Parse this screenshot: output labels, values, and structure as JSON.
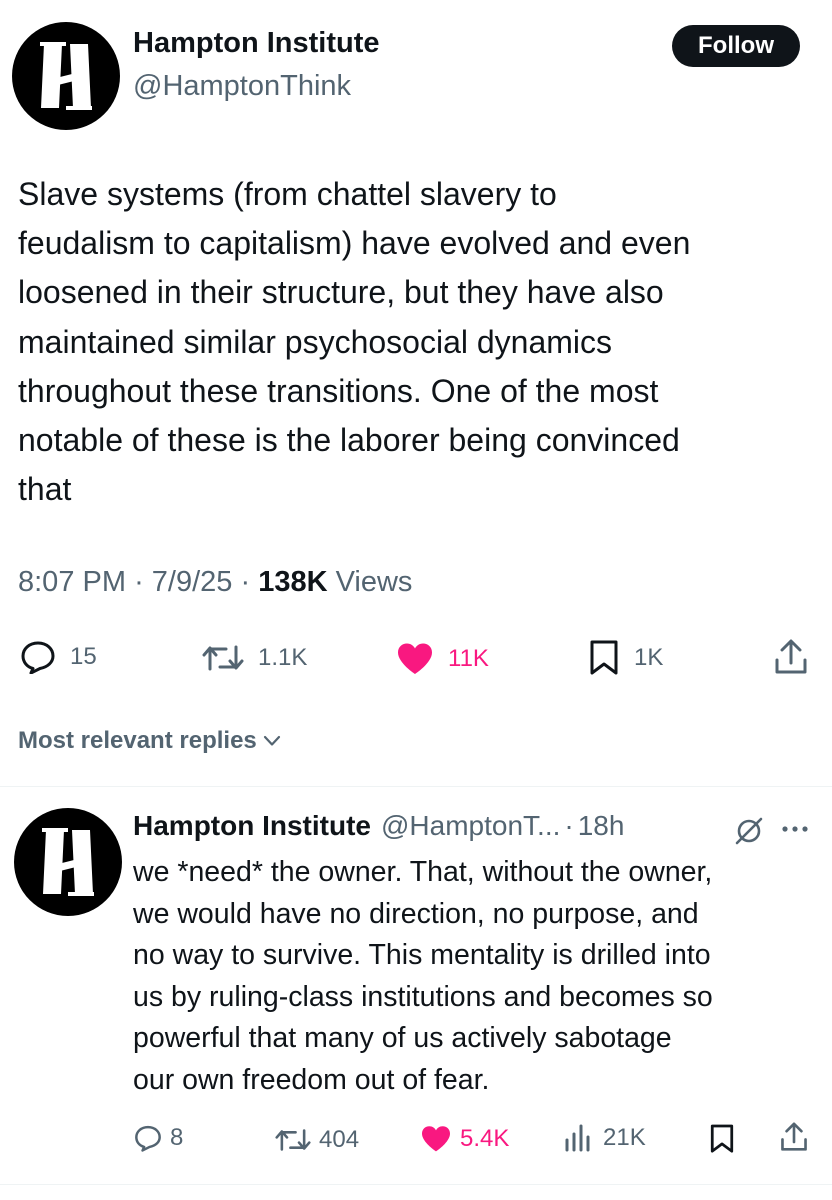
{
  "main_post": {
    "author_name": "Hampton Institute",
    "author_handle": "@HamptonThink",
    "follow_label": "Follow",
    "text": "Slave systems (from chattel slavery to\nfeudalism to capitalism) have evolved and even\nloosened in their structure, but they have also\nmaintained similar psychosocial dynamics\nthroughout these transitions. One of the most\nnotable of these is the laborer being convinced\nthat",
    "time": "8:07 PM",
    "date": "7/9/25",
    "views_count": "138K",
    "views_label": "Views",
    "actions": {
      "replies": "15",
      "reposts": "1.1K",
      "likes": "11K",
      "bookmarks": "1K"
    }
  },
  "replies_sort_label": "Most relevant replies",
  "reply": {
    "author_name": "Hampton Institute",
    "author_handle": "@HamptonT...",
    "separator": "·",
    "time": "18h",
    "text": "we *need* the owner. That, without the owner,\nwe would have no direction, no purpose, and\nno way to survive. This mentality is drilled into\nus by ruling-class institutions and becomes so\npowerful that many of us actively sabotage\nour own freedom out of fear.",
    "actions": {
      "replies": "8",
      "reposts": "404",
      "likes": "5.4K",
      "views": "21K"
    }
  },
  "colors": {
    "text": "#0f1419",
    "secondary": "#536471",
    "like": "#f91880",
    "follow_bg": "#0f1419"
  },
  "icons": [
    "logo-h-icon",
    "reply-icon",
    "repost-icon",
    "heart-icon",
    "bookmark-icon",
    "share-icon",
    "chevron-down-icon",
    "grok-icon",
    "more-icon",
    "views-icon"
  ]
}
